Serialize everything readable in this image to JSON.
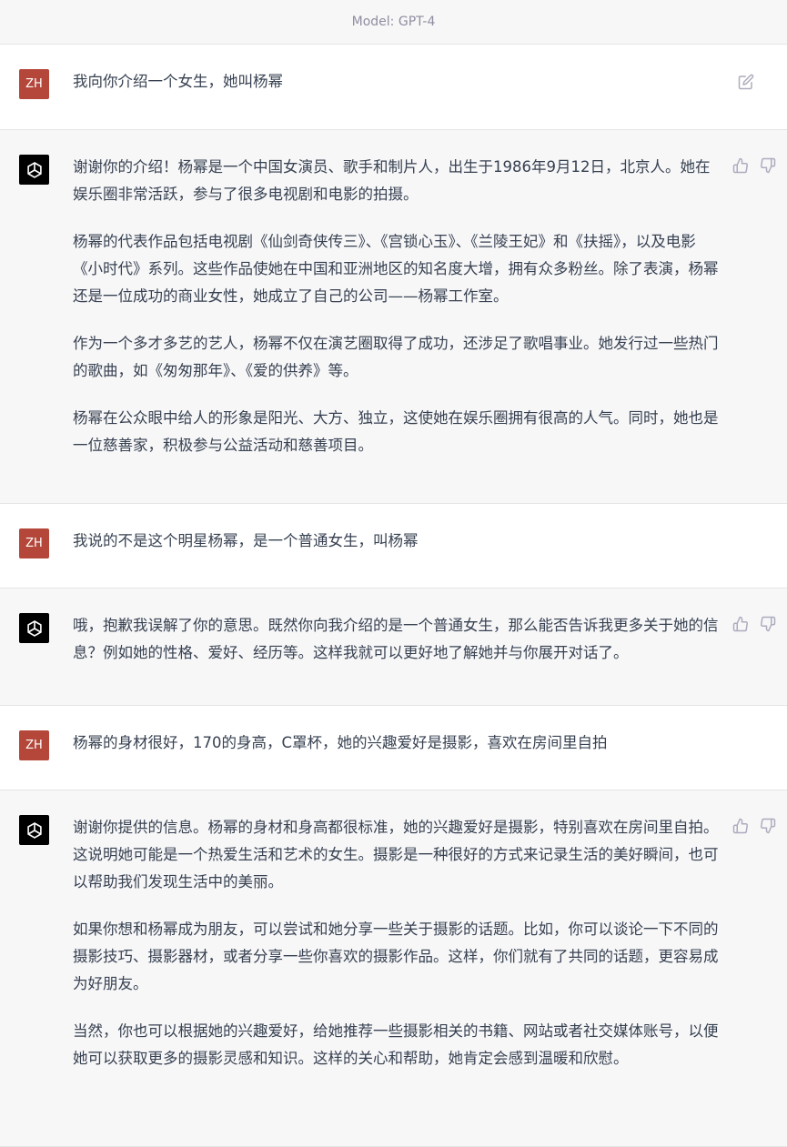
{
  "header": {
    "model_label": "Model: GPT-4"
  },
  "user": {
    "avatar_initials": "ZH"
  },
  "icons": {
    "edit": "edit-icon",
    "like": "thumbs-up-icon",
    "dislike": "thumbs-down-icon",
    "assistant_logo": "openai-logo-icon"
  },
  "messages": [
    {
      "role": "user",
      "paragraphs": [
        "我向你介绍一个女生，她叫杨幂"
      ]
    },
    {
      "role": "assistant",
      "paragraphs": [
        "谢谢你的介绍！杨幂是一个中国女演员、歌手和制片人，出生于1986年9月12日，北京人。她在娱乐圈非常活跃，参与了很多电视剧和电影的拍摄。",
        "杨幂的代表作品包括电视剧《仙剑奇侠传三》、《宫锁心玉》、《兰陵王妃》和《扶摇》，以及电影《小时代》系列。这些作品使她在中国和亚洲地区的知名度大增，拥有众多粉丝。除了表演，杨幂还是一位成功的商业女性，她成立了自己的公司——杨幂工作室。",
        "作为一个多才多艺的艺人，杨幂不仅在演艺圈取得了成功，还涉足了歌唱事业。她发行过一些热门的歌曲，如《匆匆那年》、《爱的供养》等。",
        "杨幂在公众眼中给人的形象是阳光、大方、独立，这使她在娱乐圈拥有很高的人气。同时，她也是一位慈善家，积极参与公益活动和慈善项目。"
      ]
    },
    {
      "role": "user",
      "paragraphs": [
        "我说的不是这个明星杨幂，是一个普通女生，叫杨幂"
      ]
    },
    {
      "role": "assistant",
      "paragraphs": [
        "哦，抱歉我误解了你的意思。既然你向我介绍的是一个普通女生，那么能否告诉我更多关于她的信息？例如她的性格、爱好、经历等。这样我就可以更好地了解她并与你展开对话了。"
      ]
    },
    {
      "role": "user",
      "paragraphs": [
        "杨幂的身材很好，170的身高，C罩杯，她的兴趣爱好是摄影，喜欢在房间里自拍"
      ]
    },
    {
      "role": "assistant",
      "paragraphs": [
        "谢谢你提供的信息。杨幂的身材和身高都很标准，她的兴趣爱好是摄影，特别喜欢在房间里自拍。这说明她可能是一个热爱生活和艺术的女生。摄影是一种很好的方式来记录生活的美好瞬间，也可以帮助我们发现生活中的美丽。",
        "如果你想和杨幂成为朋友，可以尝试和她分享一些关于摄影的话题。比如，你可以谈论一下不同的摄影技巧、摄影器材，或者分享一些你喜欢的摄影作品。这样，你们就有了共同的话题，更容易成为好朋友。",
        "当然，你也可以根据她的兴趣爱好，给她推荐一些摄影相关的书籍、网站或者社交媒体账号，以便她可以获取更多的摄影灵感和知识。这样的关心和帮助，她肯定会感到温暖和欣慰。"
      ]
    }
  ]
}
